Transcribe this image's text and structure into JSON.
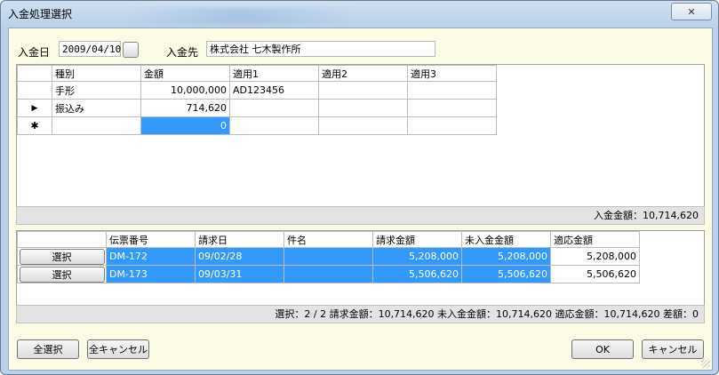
{
  "window": {
    "title": "入金処理選択",
    "close_symbol": "✕"
  },
  "header": {
    "date_label": "入金日",
    "date_value": "2009/04/10",
    "payer_label": "入金先",
    "payer_value": "株式会社 七木製作所"
  },
  "payments": {
    "columns": [
      "種別",
      "金額",
      "適用1",
      "適用2",
      "適用3"
    ],
    "rows": [
      {
        "indicator": "",
        "type": "手形",
        "amount": "10,000,000",
        "memo1": "AD123456",
        "memo2": "",
        "memo3": ""
      },
      {
        "indicator": "▶",
        "type": "振込み",
        "amount": "714,620",
        "memo1": "",
        "memo2": "",
        "memo3": ""
      },
      {
        "indicator": "✱",
        "type": "",
        "amount": "0",
        "memo1": "",
        "memo2": "",
        "memo3": ""
      }
    ],
    "total_text": "入金金額：10,714,620"
  },
  "invoices": {
    "columns": [
      "伝票番号",
      "請求日",
      "件名",
      "請求金額",
      "未入金金額",
      "適応金額"
    ],
    "select_label": "選択",
    "rows": [
      {
        "slip": "DM-172",
        "date": "09/02/28",
        "subject": "",
        "billed": "5,208,000",
        "unpaid": "5,208,000",
        "applied": "5,208,000"
      },
      {
        "slip": "DM-173",
        "date": "09/03/31",
        "subject": "",
        "billed": "5,506,620",
        "unpaid": "5,506,620",
        "applied": "5,506,620"
      }
    ],
    "summary_text": "選択：2 / 2 請求金額：10,714,620 未入金金額：10,714,620 適応金額：10,714,620 差額：0"
  },
  "buttons": {
    "select_all": "全選択",
    "cancel_all": "全キャンセル",
    "ok": "OK",
    "cancel": "キャンセル"
  }
}
